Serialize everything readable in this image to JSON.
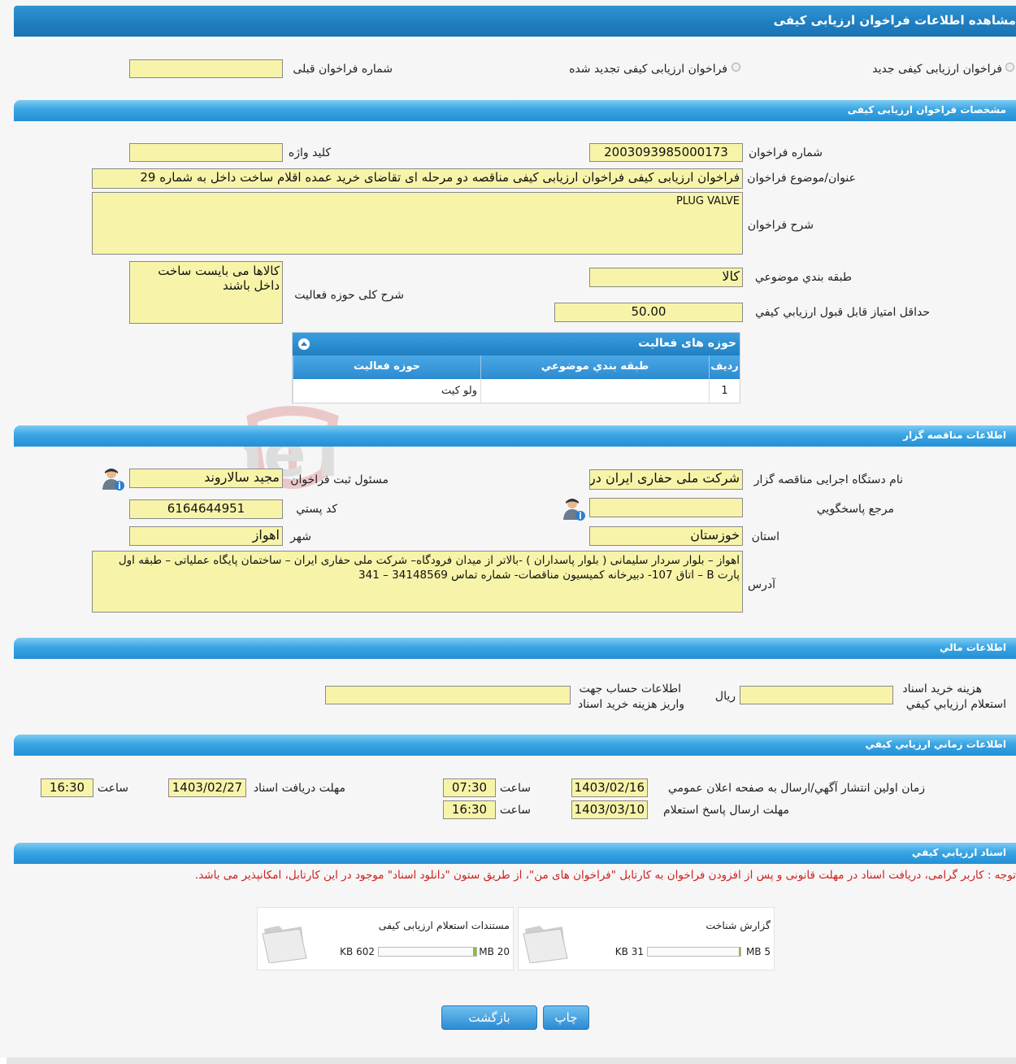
{
  "page_title": "مشاهده اطلاعات فراخوان ارزیابی کیفی",
  "call_type": {
    "option_new": "فراخوان ارزيابی کيفی جديد",
    "option_renewed": "فراخوان ارزيابی کيفی تجديد شده",
    "previous_number_label": "شماره فراخوان قبلی",
    "previous_number_value": ""
  },
  "sections": {
    "specs": "مشخصات فراخوان ارزیابی کیفی",
    "tenderer": "اطلاعات مناقصه گزار",
    "financial": "اطلاعات مالي",
    "timing": "اطلاعات زماني ارزيابي کيفي",
    "documents": "اسناد ارزيابي کيفي"
  },
  "specs": {
    "number_label": "شماره فراخوان",
    "number_value": "2003093985000173",
    "keyword_label": "کليد واژه",
    "keyword_value": "",
    "subject_label": "عنوان/موضوع فراخوان",
    "subject_value": "فراخوان ارزیابی کیفی فراخوان ارزیابی کیفی مناقصه دو مرحله ای تقاضای خرید عمده اقلام ساخت داخل به شماره 29",
    "description_label": "شرح فراخوان",
    "description_value": "PLUG VALVE",
    "category_label": "طبقه بندي موضوعي",
    "category_value": "کالا",
    "activity_desc_label": "شرح کلی حوزه فعالیت",
    "activity_desc_value": "کالاها می بایست ساخت داخل باشند",
    "min_score_label": "حداقل امتياز قابل قبول ارزيابي کيفي",
    "min_score_value": "50.00"
  },
  "activity_grid": {
    "title": "حوزه های فعالیت",
    "columns": [
      "رديف",
      "طبقه بندي موضوعي",
      "حوزه فعالیت"
    ],
    "rows": [
      [
        "1",
        "",
        "ولو کیت"
      ]
    ]
  },
  "tenderer": {
    "org_label": "نام دستگاه اجرایی مناقصه گزار",
    "org_value": "شرکت ملی حفاری ایران در",
    "registrar_label": "مسئول ثبت فراخوان",
    "registrar_value": "مجید سالاروند",
    "reference_label": "مرجع پاسخگويي",
    "reference_value": "",
    "postal_label": "کد پستي",
    "postal_value": "6164644951",
    "province_label": "استان",
    "province_value": "خوزستان",
    "city_label": "شهر",
    "city_value": "اهواز",
    "address_label": "آدرس",
    "address_value": "اهواز – بلوار سردار سلیمانی ( بلوار پاسداران ) -بالاتر از میدان فرودگاه– شرکت ملی حفاری ایران – ساختمان پایگاه عملیاتی – طبقه اول پارت B – اتاق 107- دبیرخانه کمیسیون مناقصات- شماره تماس 34148569 – 341"
  },
  "financial": {
    "fee_label_1": "هزينه خريد اسناد",
    "fee_label_2": "استعلام ارزيابي کيفي",
    "fee_value": "",
    "currency": "ريال",
    "account_label_1": "اطلاعات حساب جهت",
    "account_label_2": "واريز هزينه خريد اسناد",
    "account_value": ""
  },
  "timing": {
    "publish_label": "زمان اولين انتشار آگهي/ارسال به صفحه اعلان عمومي",
    "publish_date": "1403/02/16",
    "publish_time": "07:30",
    "time_label": "ساعت",
    "receive_label": "مهلت دريافت اسناد",
    "receive_date": "1403/02/27",
    "receive_time": "16:30",
    "reply_label": "مهلت ارسال پاسخ استعلام",
    "reply_date": "1403/03/10",
    "reply_time": "16:30"
  },
  "documents": {
    "note": "توجه : کاربر گرامی، دریافت اسناد در مهلت قانونی و پس از افزودن فراخوان به کارتابل \"فراخوان های من\"، از طریق ستون \"دانلود اسناد\" موجود در این کارتابل، امکانپذیر می باشد.",
    "files": [
      {
        "name": "گزارش شناخت",
        "max": "5 MB",
        "size": "31 KB",
        "fraction": 0.006
      },
      {
        "name": "مستندات استعلام ارزیابی کیفی",
        "max": "20 MB",
        "size": "602 KB",
        "fraction": 0.03
      }
    ]
  },
  "buttons": {
    "print": "چاپ",
    "back": "بازگشت"
  },
  "watermark": "AriaTender.neT",
  "colors": {
    "header_blue": "#1f7fc1",
    "section_blue": "#39a5e3",
    "field_yellow": "#f7f4a9",
    "note_red": "#d0201f"
  }
}
